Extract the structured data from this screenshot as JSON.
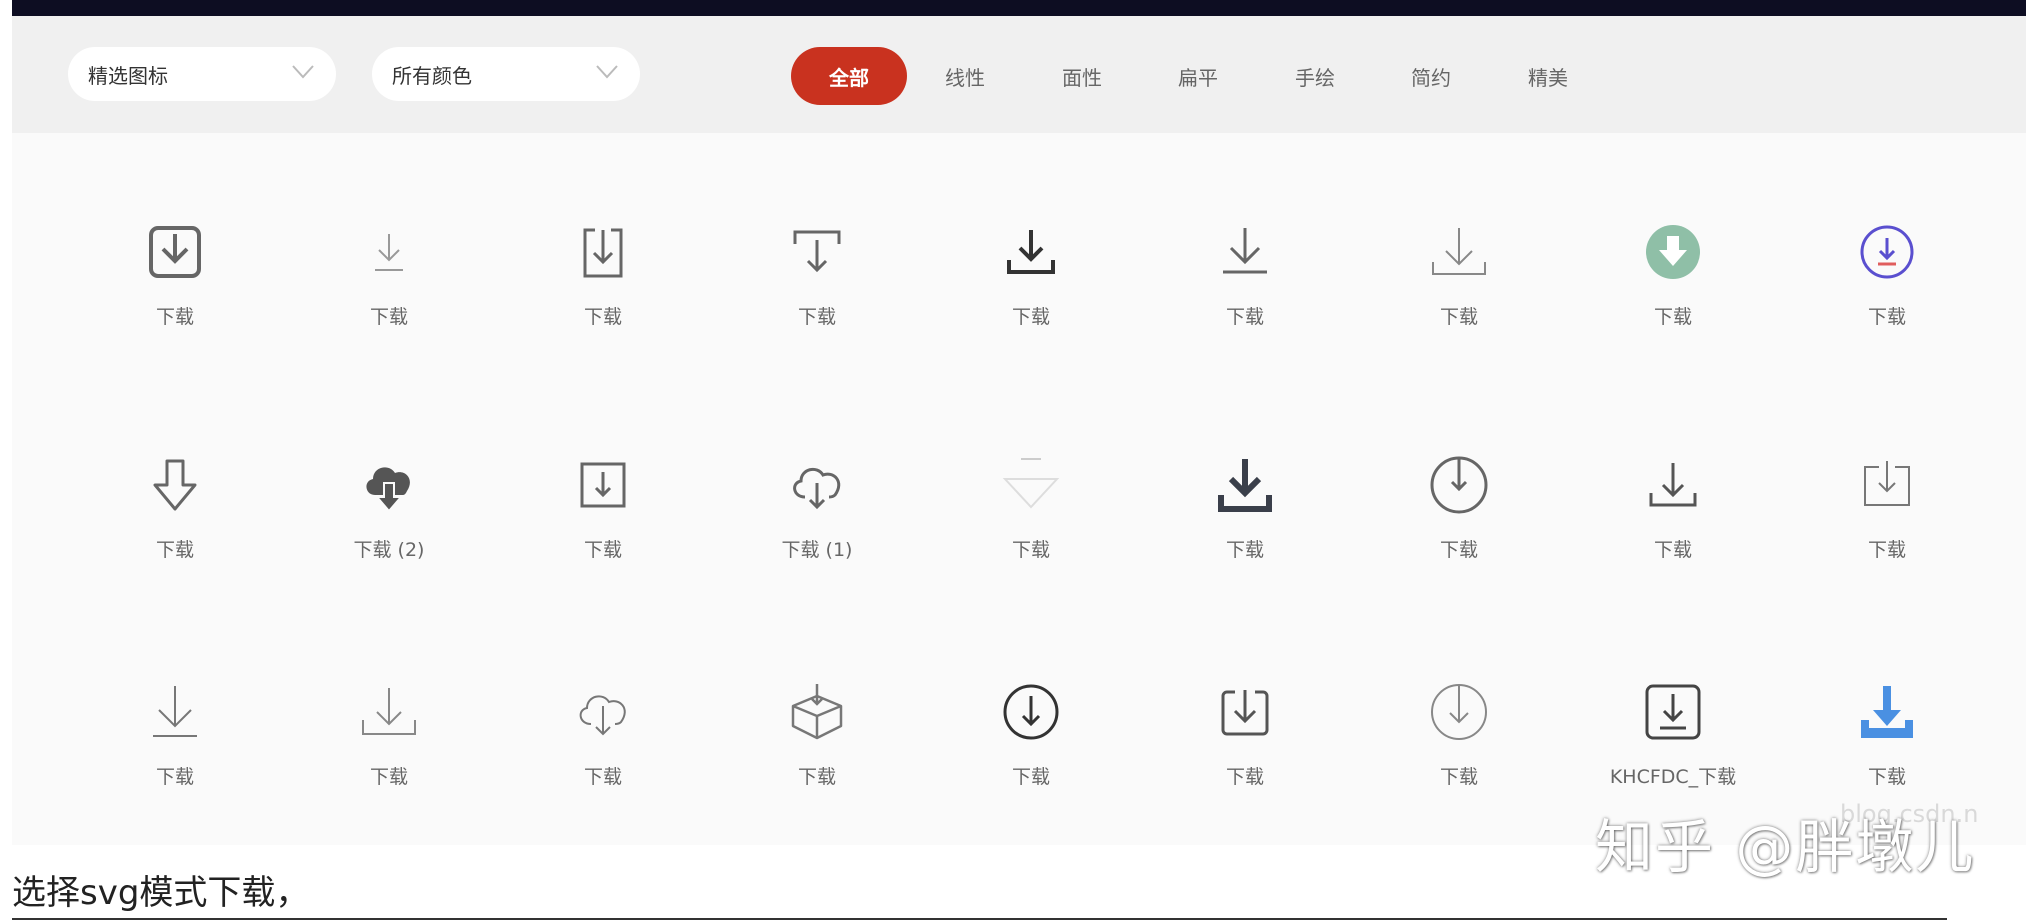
{
  "filters": {
    "category_value": "精选图标",
    "color_value": "所有颜色"
  },
  "style_tabs": [
    {
      "label": "全部",
      "active": true
    },
    {
      "label": "线性",
      "active": false
    },
    {
      "label": "面性",
      "active": false
    },
    {
      "label": "扁平",
      "active": false
    },
    {
      "label": "手绘",
      "active": false
    },
    {
      "label": "简约",
      "active": false
    },
    {
      "label": "精美",
      "active": false
    }
  ],
  "colors": {
    "accent": "#c9321f",
    "icon_gray": "#666666",
    "green_circle": "#8fbfa7",
    "purple": "#5a4fcf",
    "blue": "#4a90e2"
  },
  "icons": [
    [
      {
        "icon": "tray-download-rounded-icon",
        "label": "下载"
      },
      {
        "icon": "arrow-down-line-light-icon",
        "label": "下载"
      },
      {
        "icon": "box-download-icon",
        "label": "下载"
      },
      {
        "icon": "bracket-arrow-down-icon",
        "label": "下载"
      },
      {
        "icon": "tray-arrow-down-bold-icon",
        "label": "下载"
      },
      {
        "icon": "arrow-down-line-icon",
        "label": "下载"
      },
      {
        "icon": "tray-arrow-down-thin-icon",
        "label": "下载"
      },
      {
        "icon": "green-circle-download-icon",
        "label": "下载"
      },
      {
        "icon": "purple-circle-download-icon",
        "label": "下载"
      }
    ],
    [
      {
        "icon": "hollow-arrow-down-icon",
        "label": "下载"
      },
      {
        "icon": "cloud-download-filled-icon",
        "label": "下载 (2)"
      },
      {
        "icon": "square-download-icon",
        "label": "下载"
      },
      {
        "icon": "cloud-download-outline-icon",
        "label": "下载 (1)"
      },
      {
        "icon": "faint-triangle-down-icon",
        "label": "下载"
      },
      {
        "icon": "tray-download-heavy-icon",
        "label": "下载"
      },
      {
        "icon": "circle-arrow-down-icon",
        "label": "下载"
      },
      {
        "icon": "tray-arrow-down-icon",
        "label": "下载"
      },
      {
        "icon": "inbox-download-icon",
        "label": "下载"
      }
    ],
    [
      {
        "icon": "arrow-down-line-large-icon",
        "label": "下载"
      },
      {
        "icon": "tray-arrow-down-large-icon",
        "label": "下载"
      },
      {
        "icon": "cloud-download-outline-2-icon",
        "label": "下载"
      },
      {
        "icon": "package-download-icon",
        "label": "下载"
      },
      {
        "icon": "circle-download-bold-icon",
        "label": "下载"
      },
      {
        "icon": "tray-download-rounded-2-icon",
        "label": "下载"
      },
      {
        "icon": "circle-download-thin-icon",
        "label": "下载"
      },
      {
        "icon": "square-download-line-icon",
        "label": "KHCFDC_下载"
      },
      {
        "icon": "blue-tray-download-icon",
        "label": "下载"
      }
    ]
  ],
  "watermark": "知乎 @胖墩儿",
  "watermark_site": "blog.csdn.n",
  "caption": "选择svg模式下载，"
}
